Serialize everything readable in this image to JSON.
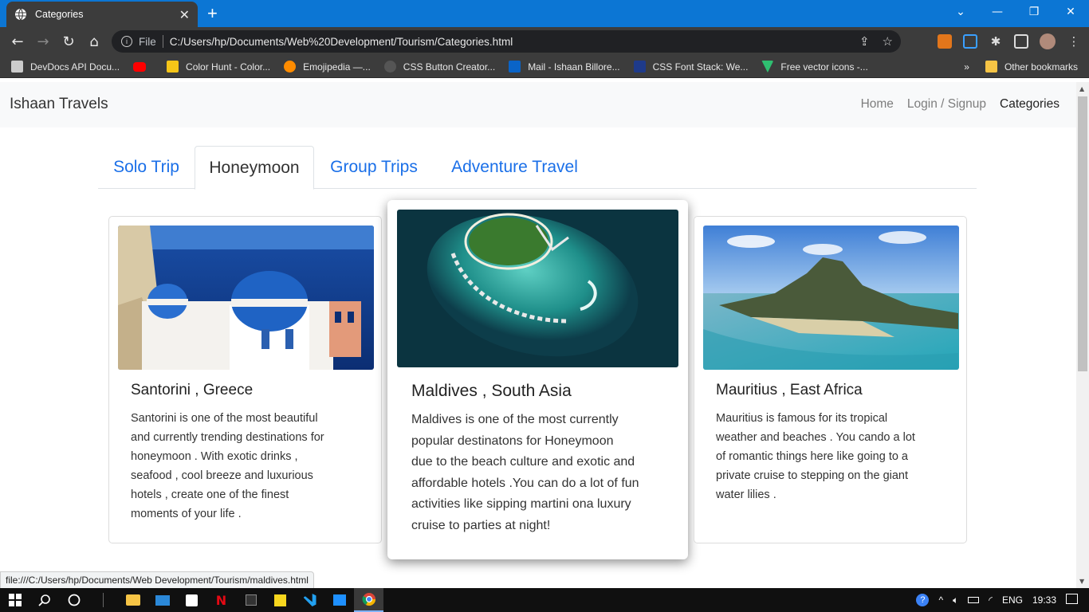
{
  "browser": {
    "tab_title": "Categories",
    "url_scheme": "File",
    "url": "C:/Users/hp/Documents/Web%20Development/Tourism/Categories.html",
    "bookmarks": [
      {
        "label": "DevDocs API Docu...",
        "color": "#cccccc"
      },
      {
        "label": "",
        "color": "#ff0000"
      },
      {
        "label": "Color Hunt - Color...",
        "color": "#f5c518"
      },
      {
        "label": "Emojipedia —...",
        "color": "#ff8c00"
      },
      {
        "label": "CSS Button Creator...",
        "color": "#555555"
      },
      {
        "label": "Mail - Ishaan Billore...",
        "color": "#0a64c8"
      },
      {
        "label": "CSS Font Stack: We...",
        "color": "#1e3a8a"
      },
      {
        "label": "Free vector icons -...",
        "color": "#2fbf71"
      }
    ],
    "more_bookmarks": "»",
    "other_bookmarks": "Other bookmarks",
    "status_url": "file:///C:/Users/hp/Documents/Web Development/Tourism/maldives.html"
  },
  "site": {
    "brand": "Ishaan Travels",
    "nav": [
      {
        "label": "Home"
      },
      {
        "label": "Login / Signup"
      },
      {
        "label": "Categories"
      }
    ],
    "tabs": [
      {
        "label": "Solo Trip"
      },
      {
        "label": "Honeymoon"
      },
      {
        "label": "Group Trips"
      },
      {
        "label": "Adventure Travel"
      }
    ],
    "cards": [
      {
        "title": "Santorini , Greece",
        "lines": [
          "Santorini is one of the most beautiful",
          "and currently trending destinations for",
          "honeymoon . With exotic drinks ,",
          "seafood , cool breeze and luxurious",
          "hotels , create one of the finest",
          "moments of your life ."
        ]
      },
      {
        "title": "Maldives , South Asia",
        "lines": [
          "Maldives is one of the most currently",
          "popular destinatons for Honeymoon",
          "due to the beach culture and exotic and",
          "affordable hotels .You can do a lot of fun",
          "activities like sipping martini ona luxury",
          "cruise to parties at night!"
        ]
      },
      {
        "title": "Mauritius , East Africa",
        "lines": [
          "Mauritius is famous for its tropical",
          "weather and beaches . You cando a lot",
          "of romantic things here like going to a",
          "private cruise to stepping on the giant",
          "water lilies ."
        ]
      }
    ]
  },
  "taskbar": {
    "lang": "ENG",
    "time": "19:33"
  },
  "colors": {
    "chrome_blue": "#0c76d4",
    "tab_link": "#1a6fe8",
    "navbar_bg": "#f8f9fa"
  }
}
